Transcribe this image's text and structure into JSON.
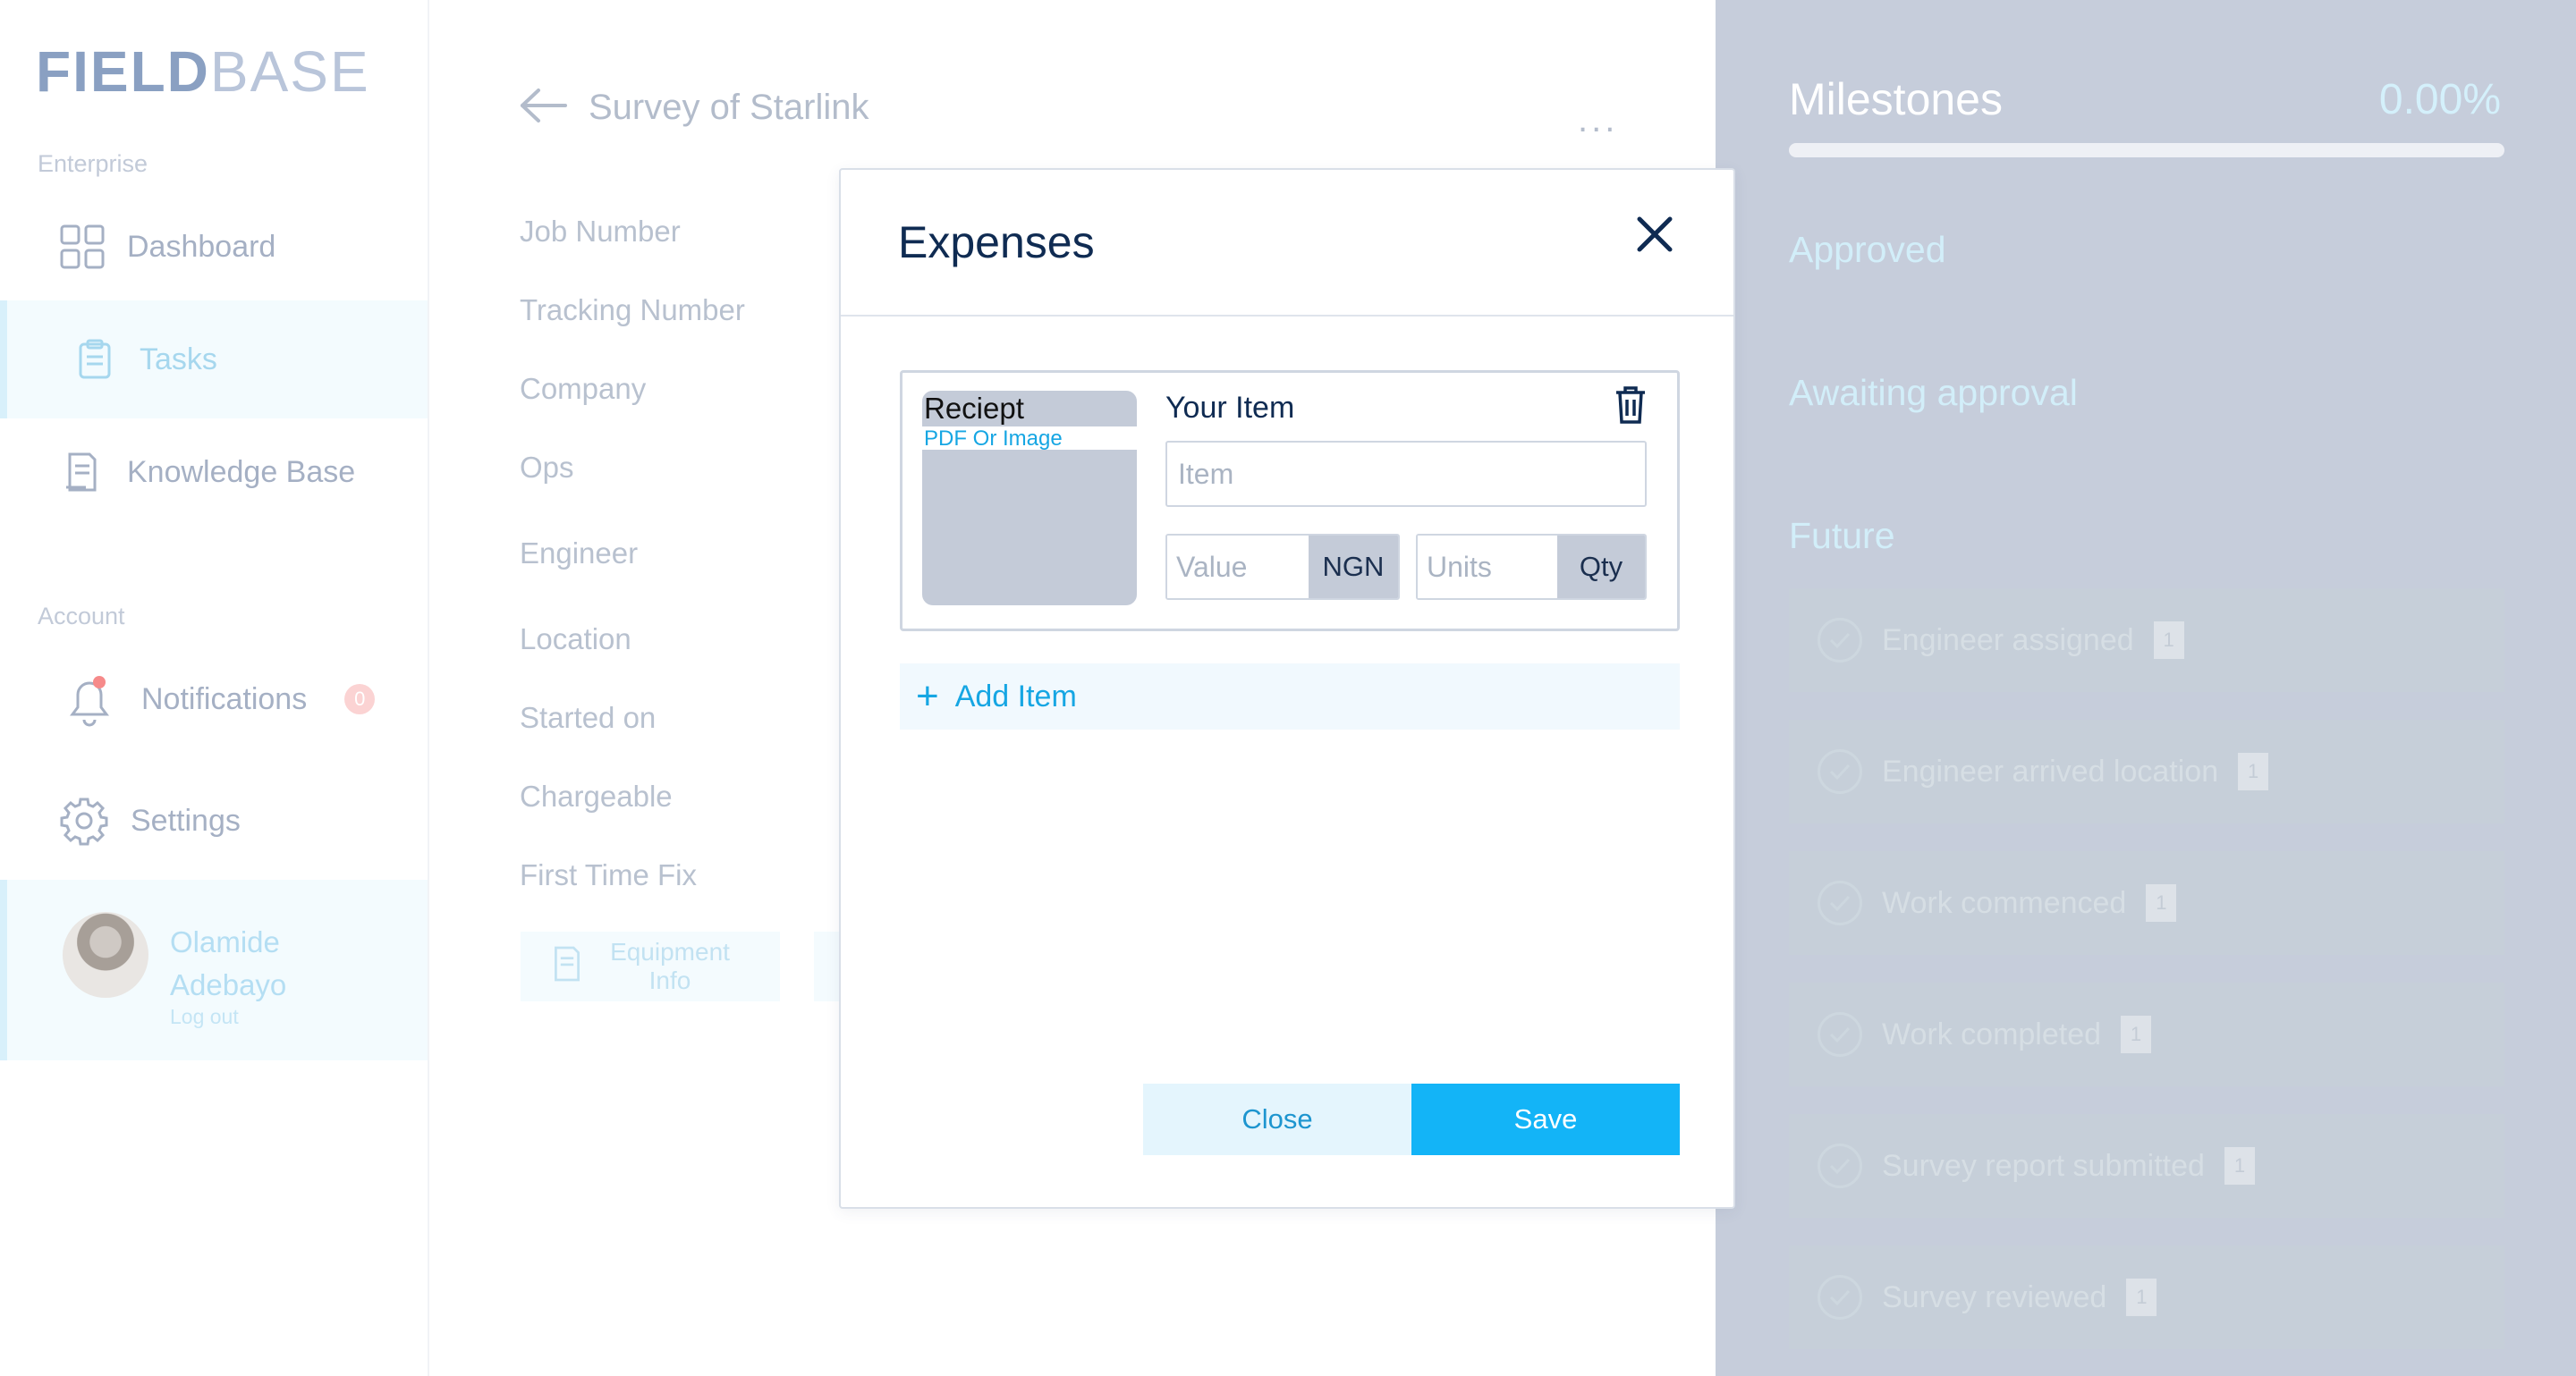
{
  "app": {
    "logo_part1": "FIELD",
    "logo_part2": "BASE"
  },
  "sidebar": {
    "enterprise_label": "Enterprise",
    "account_label": "Account",
    "items": [
      {
        "label": "Dashboard",
        "icon": "grid-icon"
      },
      {
        "label": "Tasks",
        "icon": "clipboard-icon",
        "active": true
      },
      {
        "label": "Knowledge Base",
        "icon": "document-icon"
      },
      {
        "label": "Notifications",
        "icon": "bell-icon",
        "badge": "0"
      },
      {
        "label": "Settings",
        "icon": "gear-icon"
      }
    ],
    "user": {
      "name": "Olamide Adebayo",
      "logout": "Log out"
    }
  },
  "main": {
    "title": "Survey of Starlink",
    "more": "...",
    "fields": [
      "Job Number",
      "Tracking Number",
      "Company",
      "Ops",
      "Engineer",
      "Location",
      "Started on",
      "Chargeable",
      "First Time Fix"
    ],
    "tab_equipment": "Equipment Info"
  },
  "milestones": {
    "title": "Milestones",
    "percent": "0.00%",
    "progress": 0,
    "approved": "Approved",
    "awaiting": "Awaiting approval",
    "future": "Future",
    "items": [
      {
        "label": "Engineer assigned",
        "count": "1"
      },
      {
        "label": "Engineer arrived location",
        "count": "1"
      },
      {
        "label": "Work commenced",
        "count": "1"
      },
      {
        "label": "Work completed",
        "count": "1"
      },
      {
        "label": "Survey report submitted",
        "count": "1"
      },
      {
        "label": "Survey reviewed",
        "count": "1"
      }
    ]
  },
  "modal": {
    "title": "Expenses",
    "receipt_title": "Reciept",
    "receipt_sub": "PDF Or Image",
    "your_item": "Your Item",
    "item_placeholder": "Item",
    "value_placeholder": "Value",
    "currency": "NGN",
    "units_placeholder": "Units",
    "qty": "Qty",
    "add_item": "Add Item",
    "plus": "+",
    "close": "Close",
    "save": "Save"
  },
  "colors": {
    "accent": "#13b4f7",
    "heading": "#0f2b52",
    "panel": "#c6cddb"
  }
}
